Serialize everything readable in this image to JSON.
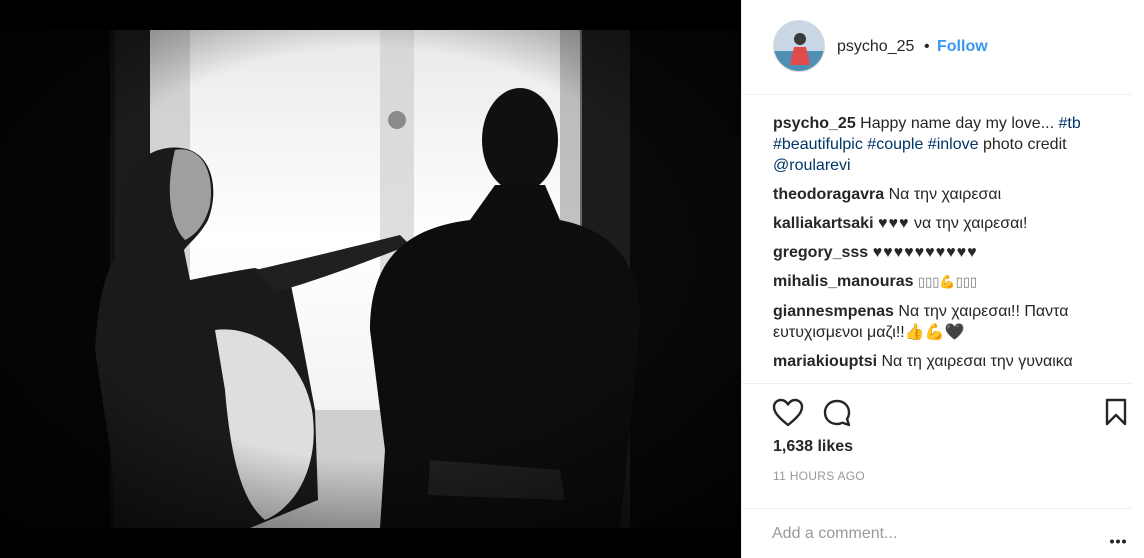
{
  "post": {
    "username": "psycho_25",
    "dot": "•",
    "follow_label": "Follow"
  },
  "caption": {
    "username": "psycho_25",
    "text": "Happy name day my love... ",
    "tags": [
      "#tb",
      "#beautifulpic",
      "#couple",
      "#inlove"
    ],
    "credit_text": "photo credit",
    "mention": "@roularevi"
  },
  "comments": [
    {
      "user": "theodoragavra",
      "text": "Να την χαιρεσαι"
    },
    {
      "user": "kalliakartsaki",
      "hearts": "♥♥♥",
      "text": "να την χαιρεσαι!"
    },
    {
      "user": "gregory_sss",
      "hearts": "♥♥♥♥♥♥♥♥♥♥"
    },
    {
      "user": "mihalis_manouras",
      "emoji": "▯▯▯💪▯▯▯"
    },
    {
      "user": "giannesmpenas",
      "text": "Να την χαιρεσαι!! Παντα ευτυχισμενοι μαζι!!👍💪🖤"
    },
    {
      "user": "mariakiouptsi",
      "text": "Να τη χαιρεσαι την γυναικα"
    }
  ],
  "actions": {
    "likes": "1,638 likes",
    "time": "11 HOURS AGO"
  },
  "add_comment": {
    "placeholder": "Add a comment..."
  },
  "icons": {
    "like": "heart-icon",
    "comment": "comment-icon",
    "save": "bookmark-icon",
    "more": "more-options-icon"
  }
}
